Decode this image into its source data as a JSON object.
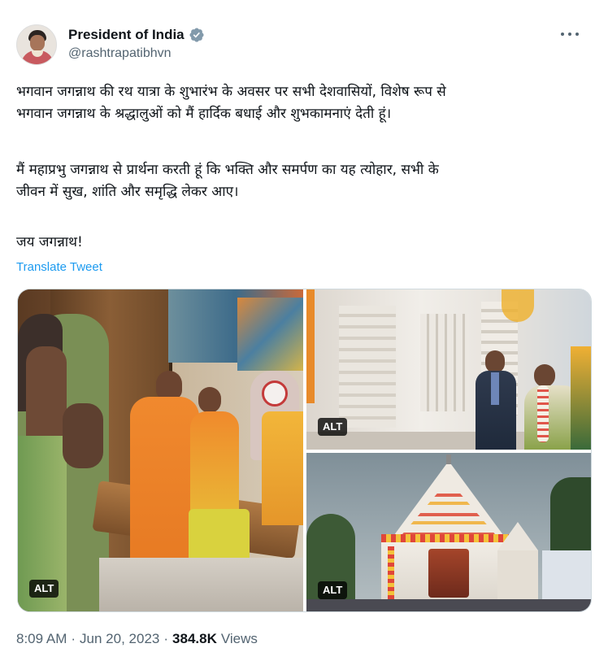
{
  "author": {
    "display_name": "President of India",
    "handle": "@rashtrapatibhvn",
    "verified_icon": "verified-badge-icon"
  },
  "tweet": {
    "paragraph_1": "भगवान जगन्नाथ की रथ यात्रा के शुभारंभ के अवसर पर सभी देशवासियों, विशेष रूप से\nभगवान जगन्नाथ के श्रद्धालुओं को मैं हार्दिक बधाई और शुभकामनाएं देती हूं।",
    "paragraph_2": "मैं महाप्रभु जगन्नाथ से प्रार्थना करती हूं कि भक्ति और समर्पण का यह त्योहार, सभी के\nजीवन में सुख, शांति और समृद्धि लेकर आए।",
    "paragraph_3": "जय जगन्नाथ!",
    "translate_label": "Translate Tweet"
  },
  "media": {
    "alt_label_1": "ALT",
    "alt_label_2": "ALT",
    "alt_label_3": "ALT"
  },
  "meta": {
    "time": "8:09 AM",
    "separator": "·",
    "date": "Jun 20, 2023",
    "views_count": "384.8K",
    "views_label": "Views"
  },
  "colors": {
    "text": "#0f1419",
    "secondary": "#536471",
    "link": "#1d9bf0",
    "verified": "#829aab"
  }
}
